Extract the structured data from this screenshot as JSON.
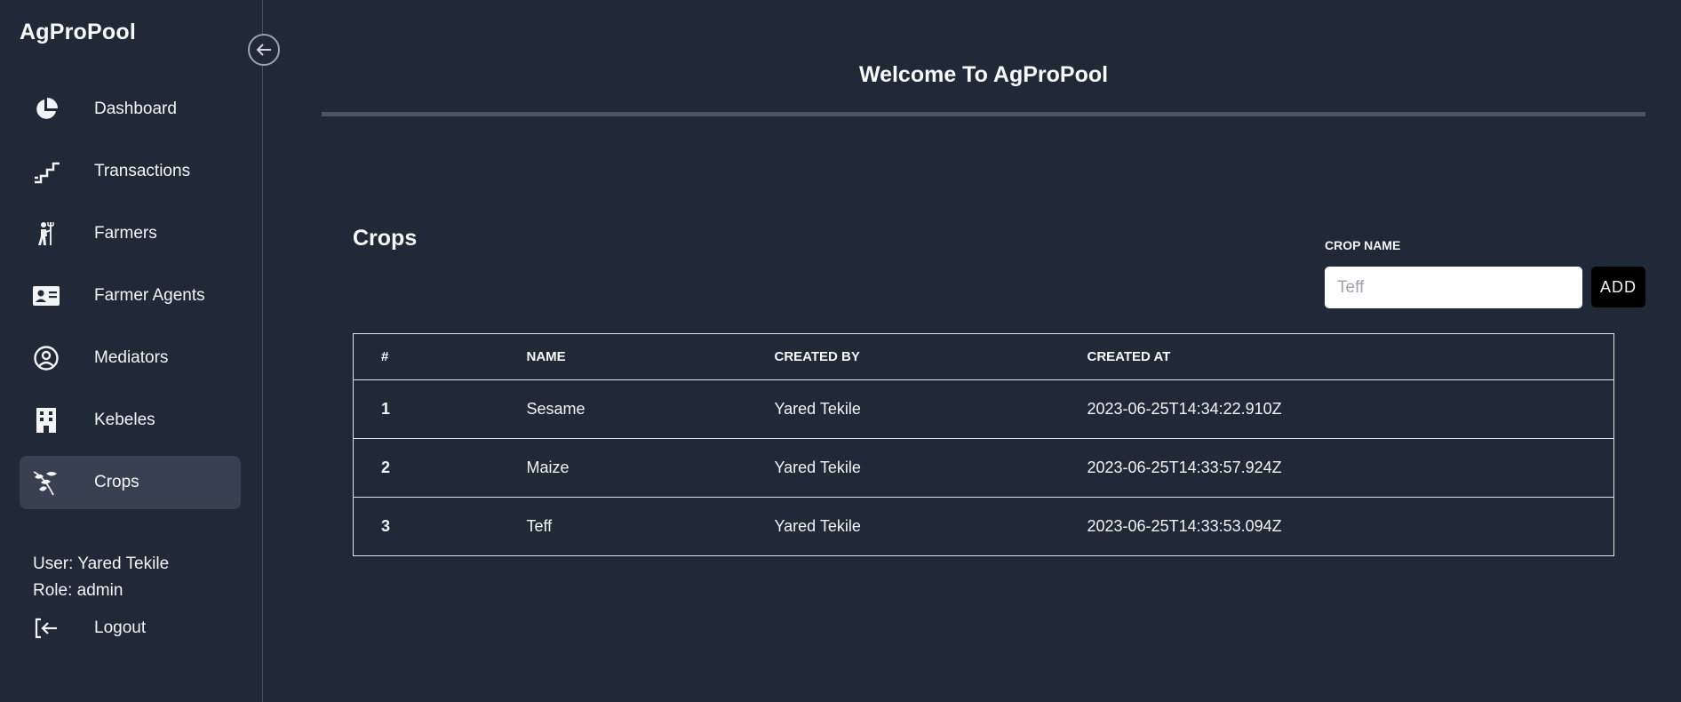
{
  "app": {
    "brand": "AgProPool"
  },
  "sidebar": {
    "items": [
      {
        "label": "Dashboard",
        "icon": "pie-chart-icon",
        "active": false
      },
      {
        "label": "Transactions",
        "icon": "stairs-icon",
        "active": false
      },
      {
        "label": "Farmers",
        "icon": "farmer-icon",
        "active": false
      },
      {
        "label": "Farmer Agents",
        "icon": "id-card-icon",
        "active": false
      },
      {
        "label": "Mediators",
        "icon": "user-circle-icon",
        "active": false
      },
      {
        "label": "Kebeles",
        "icon": "building-icon",
        "active": false
      },
      {
        "label": "Crops",
        "icon": "leaves-icon",
        "active": true
      }
    ],
    "user_line": "User: Yared Tekile",
    "role_line": "Role: admin",
    "logout_label": "Logout"
  },
  "header": {
    "title": "Welcome To AgProPool"
  },
  "main": {
    "section_title": "Crops",
    "form": {
      "label": "CROP NAME",
      "placeholder": "Teff",
      "value": "",
      "add_label": "ADD"
    },
    "table": {
      "columns": [
        "#",
        "NAME",
        "CREATED BY",
        "CREATED AT"
      ],
      "rows": [
        {
          "num": "1",
          "name": "Sesame",
          "created_by": "Yared Tekile",
          "created_at": "2023-06-25T14:34:22.910Z"
        },
        {
          "num": "2",
          "name": "Maize",
          "created_by": "Yared Tekile",
          "created_at": "2023-06-25T14:33:57.924Z"
        },
        {
          "num": "3",
          "name": "Teff",
          "created_by": "Yared Tekile",
          "created_at": "2023-06-25T14:33:53.094Z"
        }
      ]
    }
  },
  "colors": {
    "background": "#1f2937",
    "active_item": "#374151",
    "divider": "#4b5563",
    "text": "#f3f4f6"
  }
}
